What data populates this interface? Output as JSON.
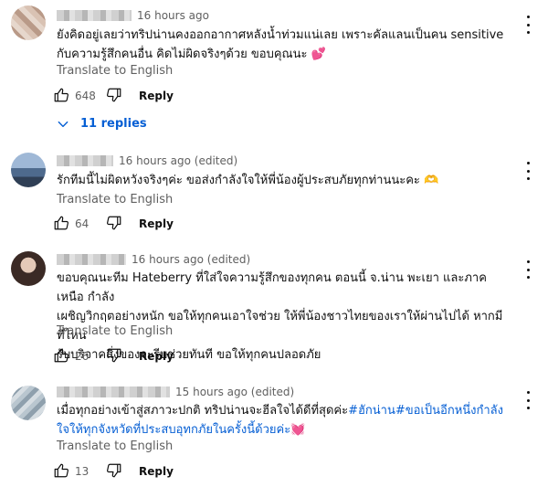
{
  "comments": [
    {
      "time": "16 hours ago",
      "text": "ยังคิดอยู่เลยว่าทริปน่านคงออกอากาศหลังน้ำท่วมแน่เลย เพราะคัลแลนเป็นคน sensitive กับความรู้สึกคนอื่น คิดไม่ผิดจริงๆด้วย ขอบคุณนะ",
      "emoji": "💕",
      "translate": "Translate to English",
      "likes": "648",
      "reply_label": "Reply",
      "replies_label": "11 replies"
    },
    {
      "time": "16 hours ago (edited)",
      "text": "รักทีมนี้ไม่ผิดหวังจริงๆค่ะ ขอส่งกำลังใจให้พี่น้องผู้ประสบภัยทุกท่านนะคะ",
      "emoji": "🫶",
      "translate": "Translate to English",
      "likes": "64",
      "reply_label": "Reply"
    },
    {
      "time": "16 hours ago (edited)",
      "line1": "ขอบคุณนะทีม Hateberry ที่ใส่ใจความรู้สึกของทุกคน ตอนนี้ จ.น่าน พะเยา และภาคเหนือ กำลัง",
      "line2": "เผชิญวิกฤตอย่างหนัก ขอให้ทุกคนเอาใจช่วย ให้พี่น้องชาวไทยของเราให้ผ่านไปได้ หากมีที่ไหน",
      "line3": "รับบริจาคสิ่งของจะรีบช่วยทันที ขอให้ทุกคนปลอดภัย",
      "translate": "Translate to English",
      "likes": "26",
      "reply_label": "Reply"
    },
    {
      "time": "15 hours ago (edited)",
      "text_plain": "เมื่อทุกอย่างเข้าสู่สภาวะปกติ ทริปน่านจะฮีลใจได้ดีที่สุดค่ะ",
      "hashtag1": "#ฮักน่าน",
      "hashtag2": "#ขอเป็นอีกหนึ่งกำลังใจให้ทุกจังหวัดที่ประสบอุทกภัยในครั้งนี้ด้วยค่ะ",
      "emoji": "💓",
      "translate": "Translate to English",
      "likes": "13",
      "reply_label": "Reply"
    }
  ]
}
